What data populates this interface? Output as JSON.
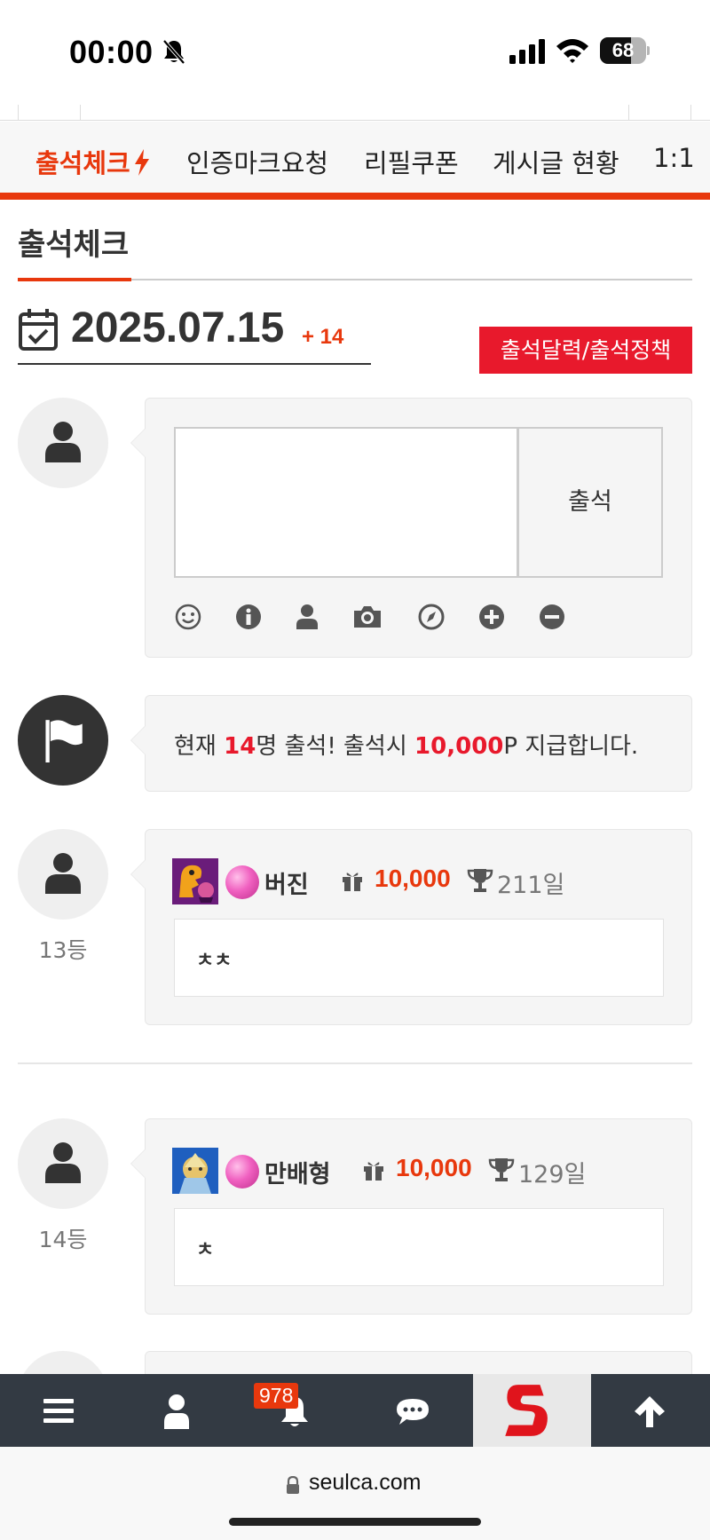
{
  "status_bar": {
    "time": "00:00",
    "battery": "68",
    "battery_level": 0.68
  },
  "tabs": [
    {
      "label": "출석체크",
      "active": true
    },
    {
      "label": "인증마크요청",
      "active": false
    },
    {
      "label": "리필쿠폰",
      "active": false
    },
    {
      "label": "게시글 현황",
      "active": false
    },
    {
      "label": "1:1",
      "active": false
    }
  ],
  "page": {
    "title": "출석체크",
    "date": "2025.07.15",
    "date_count": "+ 14",
    "policy_button": "출석달력/출석정책"
  },
  "comment_form": {
    "submit_label": "출석",
    "tools": [
      "smile-icon",
      "info-icon",
      "user-icon",
      "camera-icon",
      "compass-icon",
      "plus-circle-icon",
      "minus-circle-icon"
    ]
  },
  "notice": {
    "prefix": "현재 ",
    "count": "14",
    "mid": "명 출석! 출석시 ",
    "points": "10,000",
    "suffix": "P 지급합니다."
  },
  "entries": [
    {
      "rank": "13등",
      "name": "버진",
      "points": "10,000",
      "days": "211일",
      "message": "ㅊㅊ"
    },
    {
      "rank": "14등",
      "name": "만배형",
      "points": "10,000",
      "days": "129일",
      "message": "ㅊ"
    }
  ],
  "bottom_nav": {
    "notification_count": "978"
  },
  "url_bar": {
    "domain": "seulca.com"
  },
  "colors": {
    "accent": "#e8380d",
    "red": "#e8192c",
    "nav_bg": "#333a43"
  }
}
